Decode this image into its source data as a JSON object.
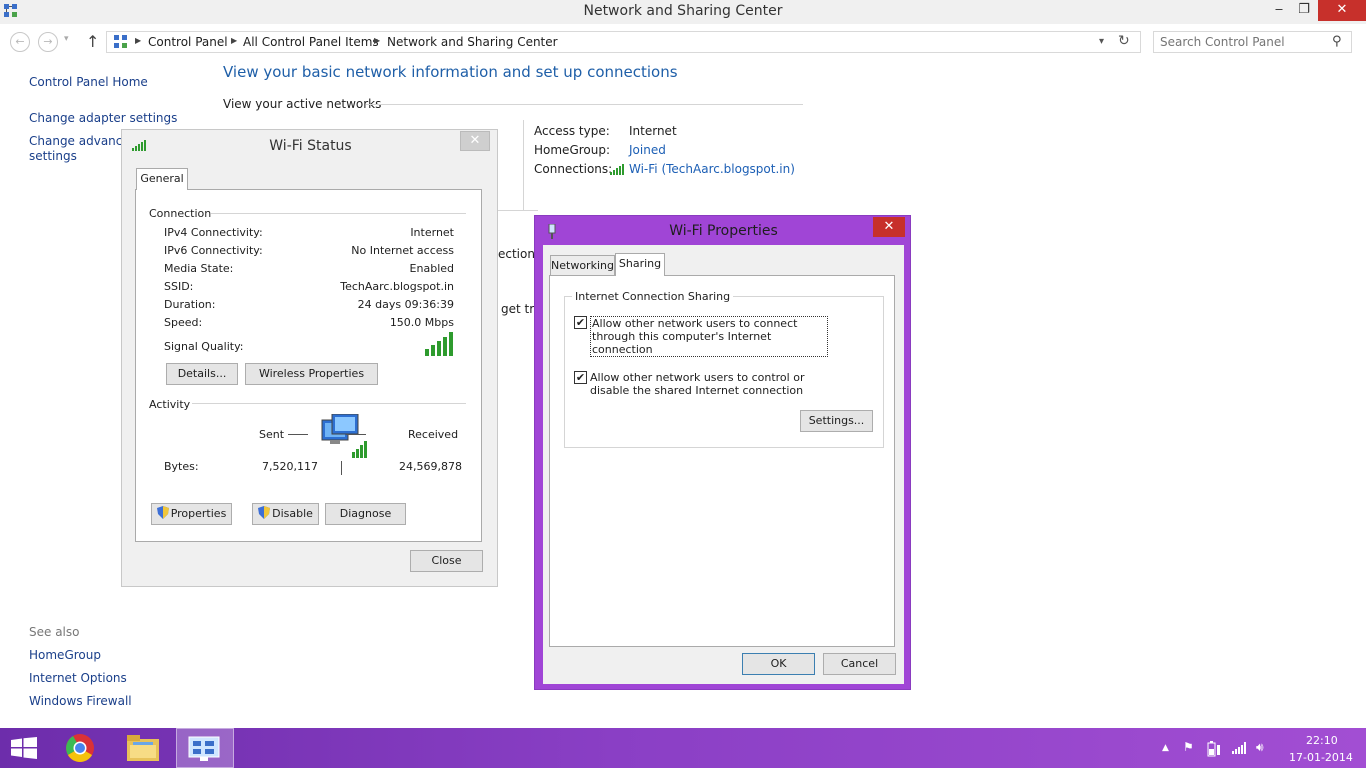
{
  "window": {
    "title": "Network and Sharing Center",
    "caption": {
      "minimize": "‒",
      "maximize": "❐",
      "close": "✕"
    }
  },
  "address_bar": {
    "breadcrumbs": [
      "Control Panel",
      "All Control Panel Items",
      "Network and Sharing Center"
    ],
    "search_placeholder": "Search Control Panel"
  },
  "left_nav": {
    "items": [
      "Control Panel Home",
      "Change adapter settings",
      "Change advanced",
      "settings"
    ],
    "see_also_label": "See also",
    "see_also": [
      "HomeGroup",
      "Internet Options",
      "Windows Firewall"
    ]
  },
  "main": {
    "heading": "View your basic network information and set up connections",
    "active_networks_label": "View your active networks",
    "access_type_label": "Access type:",
    "access_type_value": "Internet",
    "homegroup_label": "HomeGroup:",
    "homegroup_value": "Joined",
    "connections_label": "Connections:",
    "connections_value": "Wi-Fi (TechAarc.blogspot.in)",
    "obscured_text_1": "ection;",
    "obscured_text_2": "get tro"
  },
  "wifi_status": {
    "title": "Wi-Fi Status",
    "tab": "General",
    "connection_label": "Connection",
    "rows": [
      {
        "label": "IPv4 Connectivity:",
        "value": "Internet"
      },
      {
        "label": "IPv6 Connectivity:",
        "value": "No Internet access"
      },
      {
        "label": "Media State:",
        "value": "Enabled"
      },
      {
        "label": "SSID:",
        "value": "TechAarc.blogspot.in"
      },
      {
        "label": "Duration:",
        "value": "24 days 09:36:39"
      },
      {
        "label": "Speed:",
        "value": "150.0 Mbps"
      }
    ],
    "signal_quality_label": "Signal Quality:",
    "signal_bars": 5,
    "details_button": "Details...",
    "wireless_properties_button": "Wireless Properties",
    "activity_label": "Activity",
    "sent_label": "Sent",
    "received_label": "Received",
    "bytes_label": "Bytes:",
    "bytes_sent": "7,520,117",
    "bytes_received": "24,569,878",
    "properties_button": "Properties",
    "disable_button": "Disable",
    "diagnose_button": "Diagnose",
    "close_button": "Close"
  },
  "wifi_properties": {
    "title": "Wi-Fi Properties",
    "tabs": [
      "Networking",
      "Sharing"
    ],
    "active_tab": "Sharing",
    "group_label": "Internet Connection Sharing",
    "checkbox_1": "Allow other network users to connect through this computer's Internet connection",
    "checkbox_1_checked": true,
    "checkbox_2": "Allow other network users to control or disable the shared Internet connection",
    "checkbox_2_checked": true,
    "settings_button": "Settings...",
    "ok_button": "OK",
    "cancel_button": "Cancel"
  },
  "taskbar": {
    "time": "22:10",
    "date": "17-01-2014",
    "accent": "#8a3fc5"
  }
}
